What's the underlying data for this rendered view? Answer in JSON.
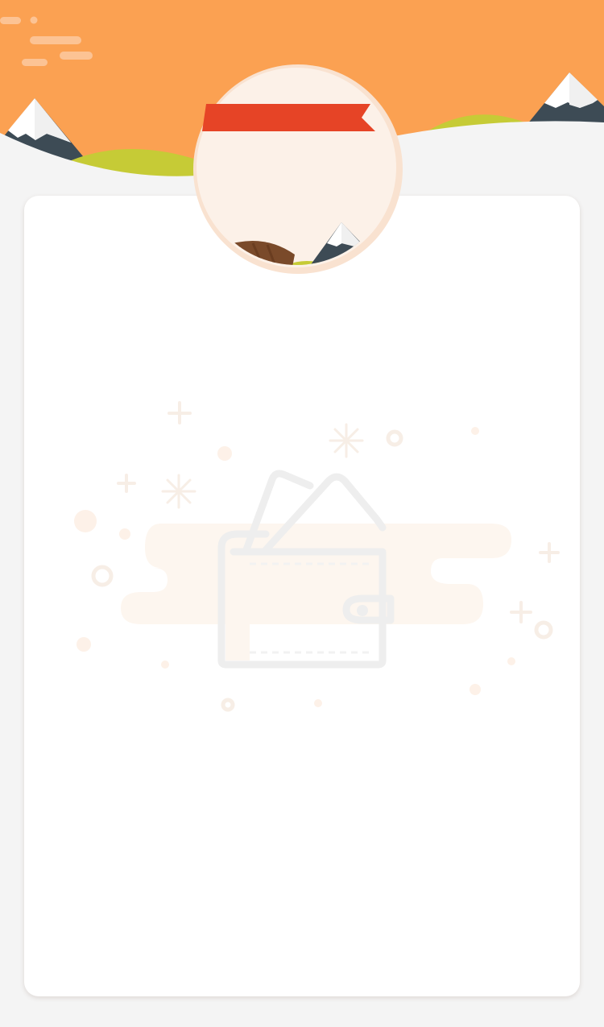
{
  "page": {
    "state": "empty",
    "theme": {
      "sky": "#fba152",
      "ground": "#f4f4f4",
      "card": "#ffffff",
      "ribbon": "#e64426",
      "badge_fill": "#fcf1e8",
      "badge_ring": "#f9e2d0",
      "hill_green": "#c6cb36",
      "mountain_dark": "#3d4b55",
      "mountain_snow": "#ffffff",
      "log_brown": "#7a4a2a",
      "placeholder_line": "#eeeeee",
      "placeholder_tint": "#fdf6ef"
    }
  },
  "header": {
    "icons": [
      "cloud-icon",
      "mountain-icon",
      "hill-icon",
      "ribbon-icon"
    ]
  },
  "empty_state": {
    "icon": "wallet-icon",
    "decorations": [
      "sparkle-icon",
      "plus-icon",
      "circle-icon",
      "dot-icon"
    ]
  }
}
